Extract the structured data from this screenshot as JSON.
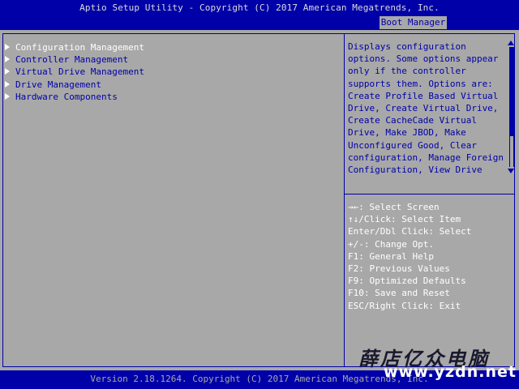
{
  "header": {
    "title": "Aptio Setup Utility - Copyright (C) 2017 American Megatrends, Inc.",
    "active_tab": "Boot Manager"
  },
  "menu": {
    "items": [
      {
        "label": "Configuration Management",
        "icon": "triangle-right-icon"
      },
      {
        "label": "Controller Management",
        "icon": "triangle-right-icon"
      },
      {
        "label": "Virtual Drive Management",
        "icon": "triangle-right-icon"
      },
      {
        "label": "Drive Management",
        "icon": "triangle-right-icon"
      },
      {
        "label": "Hardware Components",
        "icon": "triangle-right-icon"
      }
    ],
    "selected_index": 0
  },
  "help": {
    "lines": [
      "Displays configuration",
      "options. Some options appear",
      "only if the controller",
      "supports them. Options are:",
      "Create Profile Based Virtual",
      "Drive, Create Virtual Drive,",
      "Create CacheCade Virtual",
      "Drive, Make JBOD, Make",
      "Unconfigured Good, Clear",
      "configuration, Manage Foreign",
      "Configuration, View Drive"
    ]
  },
  "keys": [
    "→←: Select Screen",
    "↑↓/Click: Select Item",
    "Enter/Dbl Click: Select",
    "+/-: Change Opt.",
    "F1: General Help",
    "F2: Previous Values",
    "F9: Optimized Defaults",
    "F10: Save and Reset",
    "ESC/Right Click: Exit"
  ],
  "footer": {
    "text": "Version 2.18.1264. Copyright (C) 2017 American Megatrends, Inc."
  },
  "watermark": {
    "chinese": "薛店亿众电脑",
    "url": "www.yzdn.net"
  },
  "colors": {
    "bios_blue": "#0000a8",
    "bios_gray": "#a8a8a8",
    "highlight": "#ffffff"
  }
}
